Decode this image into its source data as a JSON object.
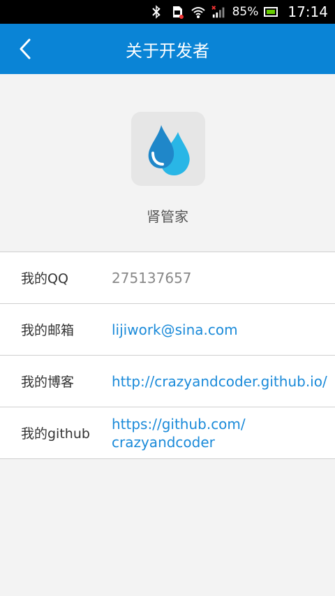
{
  "status_bar": {
    "battery_percent": "85%",
    "time": "17:14"
  },
  "app_bar": {
    "title": "关于开发者"
  },
  "app": {
    "name": "肾管家"
  },
  "info": {
    "rows": [
      {
        "label": "我的QQ",
        "value": "275137657"
      },
      {
        "label": "我的邮箱",
        "value": "lijiwork@sina.com"
      },
      {
        "label": "我的博客",
        "value": "http://crazyandcoder.github.io/"
      },
      {
        "label": "我的github",
        "value_line1": "https://github.com/",
        "value_line2": "crazyandcoder"
      }
    ]
  },
  "colors": {
    "app_bar": "#0a84d6",
    "link": "#1a8ad9"
  }
}
